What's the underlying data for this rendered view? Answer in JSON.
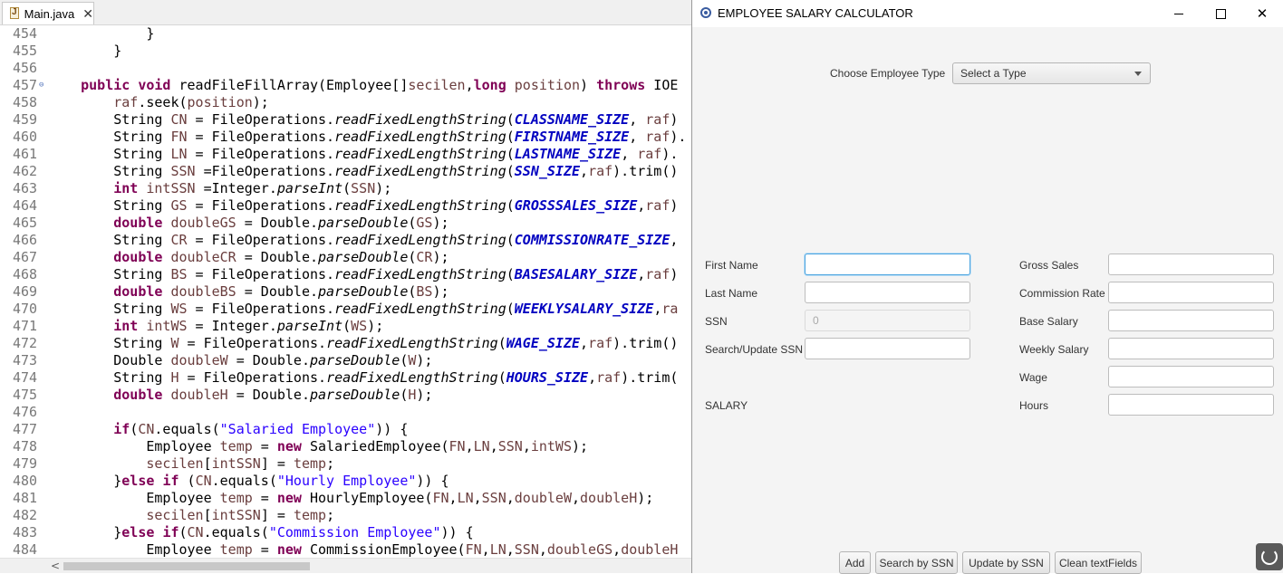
{
  "editor": {
    "tab": {
      "filename": "Main.java",
      "close": "✕"
    },
    "lines": [
      {
        "n": "454",
        "tokens": [
          [
            "",
            "            }"
          ]
        ]
      },
      {
        "n": "455",
        "tokens": [
          [
            "",
            "        }"
          ]
        ]
      },
      {
        "n": "456",
        "tokens": [
          [
            "",
            ""
          ]
        ]
      },
      {
        "n": "457",
        "fold": "⊖",
        "tokens": [
          [
            "",
            "    "
          ],
          [
            "kw",
            "public"
          ],
          [
            "",
            " "
          ],
          [
            "kw",
            "void"
          ],
          [
            "",
            " readFileFillArray(Employee[]"
          ],
          [
            "vr",
            "secilen"
          ],
          [
            "",
            ","
          ],
          [
            "kw",
            "long"
          ],
          [
            "",
            " "
          ],
          [
            "vr",
            "position"
          ],
          [
            "",
            ") "
          ],
          [
            "kw",
            "throws"
          ],
          [
            "",
            " IOE"
          ]
        ]
      },
      {
        "n": "458",
        "tokens": [
          [
            "",
            "        "
          ],
          [
            "vr",
            "raf"
          ],
          [
            "",
            ".seek("
          ],
          [
            "vr",
            "position"
          ],
          [
            "",
            ");"
          ]
        ]
      },
      {
        "n": "459",
        "tokens": [
          [
            "",
            "        String "
          ],
          [
            "vr",
            "CN"
          ],
          [
            "",
            " = FileOperations."
          ],
          [
            "it",
            "readFixedLengthString"
          ],
          [
            "",
            "("
          ],
          [
            "fd",
            "CLASSNAME_SIZE"
          ],
          [
            "",
            ", "
          ],
          [
            "vr",
            "raf"
          ],
          [
            "",
            ")"
          ]
        ]
      },
      {
        "n": "460",
        "tokens": [
          [
            "",
            "        String "
          ],
          [
            "vr",
            "FN"
          ],
          [
            "",
            " = FileOperations."
          ],
          [
            "it",
            "readFixedLengthString"
          ],
          [
            "",
            "("
          ],
          [
            "fd",
            "FIRSTNAME_SIZE"
          ],
          [
            "",
            ", "
          ],
          [
            "vr",
            "raf"
          ],
          [
            "",
            ")."
          ]
        ]
      },
      {
        "n": "461",
        "tokens": [
          [
            "",
            "        String "
          ],
          [
            "vr",
            "LN"
          ],
          [
            "",
            " = FileOperations."
          ],
          [
            "it",
            "readFixedLengthString"
          ],
          [
            "",
            "("
          ],
          [
            "fd",
            "LASTNAME_SIZE"
          ],
          [
            "",
            ", "
          ],
          [
            "vr",
            "raf"
          ],
          [
            "",
            ")."
          ]
        ]
      },
      {
        "n": "462",
        "tokens": [
          [
            "",
            "        String "
          ],
          [
            "vr",
            "SSN"
          ],
          [
            "",
            " =FileOperations."
          ],
          [
            "it",
            "readFixedLengthString"
          ],
          [
            "",
            "("
          ],
          [
            "fd",
            "SSN_SIZE"
          ],
          [
            "",
            ","
          ],
          [
            "vr",
            "raf"
          ],
          [
            "",
            ").trim()"
          ]
        ]
      },
      {
        "n": "463",
        "tokens": [
          [
            "",
            "        "
          ],
          [
            "kw",
            "int"
          ],
          [
            "",
            " "
          ],
          [
            "vr",
            "intSSN"
          ],
          [
            "",
            " =Integer."
          ],
          [
            "it",
            "parseInt"
          ],
          [
            "",
            "("
          ],
          [
            "vr",
            "SSN"
          ],
          [
            "",
            ");"
          ]
        ]
      },
      {
        "n": "464",
        "tokens": [
          [
            "",
            "        String "
          ],
          [
            "vr",
            "GS"
          ],
          [
            "",
            " = FileOperations."
          ],
          [
            "it",
            "readFixedLengthString"
          ],
          [
            "",
            "("
          ],
          [
            "fd",
            "GROSSSALES_SIZE"
          ],
          [
            "",
            ","
          ],
          [
            "vr",
            "raf"
          ],
          [
            "",
            ")"
          ]
        ]
      },
      {
        "n": "465",
        "tokens": [
          [
            "",
            "        "
          ],
          [
            "kw",
            "double"
          ],
          [
            "",
            " "
          ],
          [
            "vr",
            "doubleGS"
          ],
          [
            "",
            " = Double."
          ],
          [
            "it",
            "parseDouble"
          ],
          [
            "",
            "("
          ],
          [
            "vr",
            "GS"
          ],
          [
            "",
            ");"
          ]
        ]
      },
      {
        "n": "466",
        "tokens": [
          [
            "",
            "        String "
          ],
          [
            "vr",
            "CR"
          ],
          [
            "",
            " = FileOperations."
          ],
          [
            "it",
            "readFixedLengthString"
          ],
          [
            "",
            "("
          ],
          [
            "fd",
            "COMMISSIONRATE_SIZE"
          ],
          [
            "",
            ","
          ]
        ]
      },
      {
        "n": "467",
        "tokens": [
          [
            "",
            "        "
          ],
          [
            "kw",
            "double"
          ],
          [
            "",
            " "
          ],
          [
            "vr",
            "doubleCR"
          ],
          [
            "",
            " = Double."
          ],
          [
            "it",
            "parseDouble"
          ],
          [
            "",
            "("
          ],
          [
            "vr",
            "CR"
          ],
          [
            "",
            ");"
          ]
        ]
      },
      {
        "n": "468",
        "tokens": [
          [
            "",
            "        String "
          ],
          [
            "vr",
            "BS"
          ],
          [
            "",
            " = FileOperations."
          ],
          [
            "it",
            "readFixedLengthString"
          ],
          [
            "",
            "("
          ],
          [
            "fd",
            "BASESALARY_SIZE"
          ],
          [
            "",
            ","
          ],
          [
            "vr",
            "raf"
          ],
          [
            "",
            ")"
          ]
        ]
      },
      {
        "n": "469",
        "tokens": [
          [
            "",
            "        "
          ],
          [
            "kw",
            "double"
          ],
          [
            "",
            " "
          ],
          [
            "vr",
            "doubleBS"
          ],
          [
            "",
            " = Double."
          ],
          [
            "it",
            "parseDouble"
          ],
          [
            "",
            "("
          ],
          [
            "vr",
            "BS"
          ],
          [
            "",
            ");"
          ]
        ]
      },
      {
        "n": "470",
        "tokens": [
          [
            "",
            "        String "
          ],
          [
            "vr",
            "WS"
          ],
          [
            "",
            " = FileOperations."
          ],
          [
            "it",
            "readFixedLengthString"
          ],
          [
            "",
            "("
          ],
          [
            "fd",
            "WEEKLYSALARY_SIZE"
          ],
          [
            "",
            ","
          ],
          [
            "vr",
            "ra"
          ]
        ]
      },
      {
        "n": "471",
        "tokens": [
          [
            "",
            "        "
          ],
          [
            "kw",
            "int"
          ],
          [
            "",
            " "
          ],
          [
            "vr",
            "intWS"
          ],
          [
            "",
            " = Integer."
          ],
          [
            "it",
            "parseInt"
          ],
          [
            "",
            "("
          ],
          [
            "vr",
            "WS"
          ],
          [
            "",
            ");"
          ]
        ]
      },
      {
        "n": "472",
        "tokens": [
          [
            "",
            "        String "
          ],
          [
            "vr",
            "W"
          ],
          [
            "",
            " = FileOperations."
          ],
          [
            "it",
            "readFixedLengthString"
          ],
          [
            "",
            "("
          ],
          [
            "fd",
            "WAGE_SIZE"
          ],
          [
            "",
            ","
          ],
          [
            "vr",
            "raf"
          ],
          [
            "",
            ").trim()"
          ]
        ]
      },
      {
        "n": "473",
        "tokens": [
          [
            "",
            "        Double "
          ],
          [
            "vr",
            "doubleW"
          ],
          [
            "",
            " = Double."
          ],
          [
            "it",
            "parseDouble"
          ],
          [
            "",
            "("
          ],
          [
            "vr",
            "W"
          ],
          [
            "",
            ");"
          ]
        ]
      },
      {
        "n": "474",
        "tokens": [
          [
            "",
            "        String "
          ],
          [
            "vr",
            "H"
          ],
          [
            "",
            " = FileOperations."
          ],
          [
            "it",
            "readFixedLengthString"
          ],
          [
            "",
            "("
          ],
          [
            "fd",
            "HOURS_SIZE"
          ],
          [
            "",
            ","
          ],
          [
            "vr",
            "raf"
          ],
          [
            "",
            ").trim("
          ]
        ]
      },
      {
        "n": "475",
        "tokens": [
          [
            "",
            "        "
          ],
          [
            "kw",
            "double"
          ],
          [
            "",
            " "
          ],
          [
            "vr",
            "doubleH"
          ],
          [
            "",
            " = Double."
          ],
          [
            "it",
            "parseDouble"
          ],
          [
            "",
            "("
          ],
          [
            "vr",
            "H"
          ],
          [
            "",
            ");"
          ]
        ]
      },
      {
        "n": "476",
        "tokens": [
          [
            "",
            ""
          ]
        ]
      },
      {
        "n": "477",
        "tokens": [
          [
            "",
            "        "
          ],
          [
            "kw",
            "if"
          ],
          [
            "",
            "("
          ],
          [
            "vr",
            "CN"
          ],
          [
            "",
            ".equals("
          ],
          [
            "st",
            "\"Salaried Employee\""
          ],
          [
            "",
            ")) {"
          ]
        ]
      },
      {
        "n": "478",
        "tokens": [
          [
            "",
            "            Employee "
          ],
          [
            "vr",
            "temp"
          ],
          [
            "",
            " = "
          ],
          [
            "kw",
            "new"
          ],
          [
            "",
            " SalariedEmployee("
          ],
          [
            "vr",
            "FN"
          ],
          [
            "",
            ","
          ],
          [
            "vr",
            "LN"
          ],
          [
            "",
            ","
          ],
          [
            "vr",
            "SSN"
          ],
          [
            "",
            ","
          ],
          [
            "vr",
            "intWS"
          ],
          [
            "",
            ");"
          ]
        ]
      },
      {
        "n": "479",
        "tokens": [
          [
            "",
            "            "
          ],
          [
            "vr",
            "secilen"
          ],
          [
            "",
            "["
          ],
          [
            "vr",
            "intSSN"
          ],
          [
            "",
            "] = "
          ],
          [
            "vr",
            "temp"
          ],
          [
            "",
            ";"
          ]
        ]
      },
      {
        "n": "480",
        "tokens": [
          [
            "",
            "        }"
          ],
          [
            "kw",
            "else"
          ],
          [
            "",
            " "
          ],
          [
            "kw",
            "if"
          ],
          [
            "",
            " ("
          ],
          [
            "vr",
            "CN"
          ],
          [
            "",
            ".equals("
          ],
          [
            "st",
            "\"Hourly Employee\""
          ],
          [
            "",
            ")) {"
          ]
        ]
      },
      {
        "n": "481",
        "tokens": [
          [
            "",
            "            Employee "
          ],
          [
            "vr",
            "temp"
          ],
          [
            "",
            " = "
          ],
          [
            "kw",
            "new"
          ],
          [
            "",
            " HourlyEmployee("
          ],
          [
            "vr",
            "FN"
          ],
          [
            "",
            ","
          ],
          [
            "vr",
            "LN"
          ],
          [
            "",
            ","
          ],
          [
            "vr",
            "SSN"
          ],
          [
            "",
            ","
          ],
          [
            "vr",
            "doubleW"
          ],
          [
            "",
            ","
          ],
          [
            "vr",
            "doubleH"
          ],
          [
            "",
            ");"
          ]
        ]
      },
      {
        "n": "482",
        "tokens": [
          [
            "",
            "            "
          ],
          [
            "vr",
            "secilen"
          ],
          [
            "",
            "["
          ],
          [
            "vr",
            "intSSN"
          ],
          [
            "",
            "] = "
          ],
          [
            "vr",
            "temp"
          ],
          [
            "",
            ";"
          ]
        ]
      },
      {
        "n": "483",
        "tokens": [
          [
            "",
            "        }"
          ],
          [
            "kw",
            "else"
          ],
          [
            "",
            " "
          ],
          [
            "kw",
            "if"
          ],
          [
            "",
            "("
          ],
          [
            "vr",
            "CN"
          ],
          [
            "",
            ".equals("
          ],
          [
            "st",
            "\"Commission Employee\""
          ],
          [
            "",
            ")) {"
          ]
        ]
      },
      {
        "n": "484",
        "tokens": [
          [
            "",
            "            Employee "
          ],
          [
            "vr",
            "temp"
          ],
          [
            "",
            " = "
          ],
          [
            "kw",
            "new"
          ],
          [
            "",
            " CommissionEmployee("
          ],
          [
            "vr",
            "FN"
          ],
          [
            "",
            ","
          ],
          [
            "vr",
            "LN"
          ],
          [
            "",
            ","
          ],
          [
            "vr",
            "SSN"
          ],
          [
            "",
            ","
          ],
          [
            "vr",
            "doubleGS"
          ],
          [
            "",
            ","
          ],
          [
            "vr",
            "doubleH"
          ]
        ]
      }
    ],
    "scroll_left_arrow": "<"
  },
  "window": {
    "title": "EMPLOYEE SALARY CALCULATOR",
    "controls": {
      "minimize": "minimize",
      "maximize": "maximize",
      "close": "✕"
    }
  },
  "form": {
    "type_label": "Choose Employee Type",
    "type_selected": "Select a Type",
    "first_name_label": "First Name",
    "first_name_value": "",
    "last_name_label": "Last Name",
    "last_name_value": "",
    "ssn_label": "SSN",
    "ssn_value": "0",
    "search_ssn_label": "Search/Update SSN",
    "search_ssn_value": "",
    "salary_label": "SALARY",
    "gross_sales_label": "Gross Sales",
    "commission_rate_label": "Commission Rate",
    "base_salary_label": "Base Salary",
    "weekly_salary_label": "Weekly Salary",
    "wage_label": "Wage",
    "hours_label": "Hours"
  },
  "buttons": {
    "add": "Add",
    "search": "Search by SSN",
    "update": "Update by SSN",
    "clean": "Clean textFields"
  }
}
